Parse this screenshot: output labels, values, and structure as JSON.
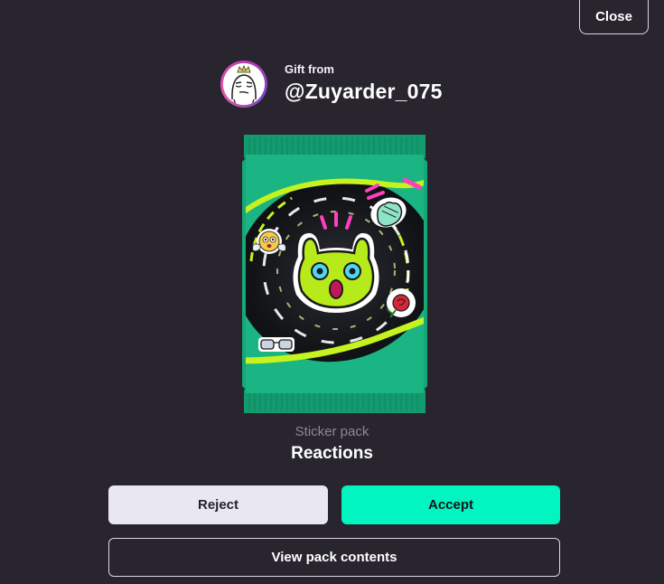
{
  "header": {
    "close_label": "Close"
  },
  "gift": {
    "from_label": "Gift from",
    "username": "@Zuyarder_075",
    "avatar_icon": "smug-face-avatar"
  },
  "pack": {
    "type_label": "Sticker pack",
    "name": "Reactions",
    "art_icon": "sticker-pack-art",
    "colors": {
      "wrapper": "#19a77a",
      "accent_lime": "#c6f21d",
      "accent_pink": "#ff3fbf"
    }
  },
  "actions": {
    "reject_label": "Reject",
    "accept_label": "Accept",
    "view_label": "View pack contents"
  },
  "colors": {
    "background": "#28252f",
    "accept": "#00f5c0",
    "reject": "#e9e7f0"
  }
}
